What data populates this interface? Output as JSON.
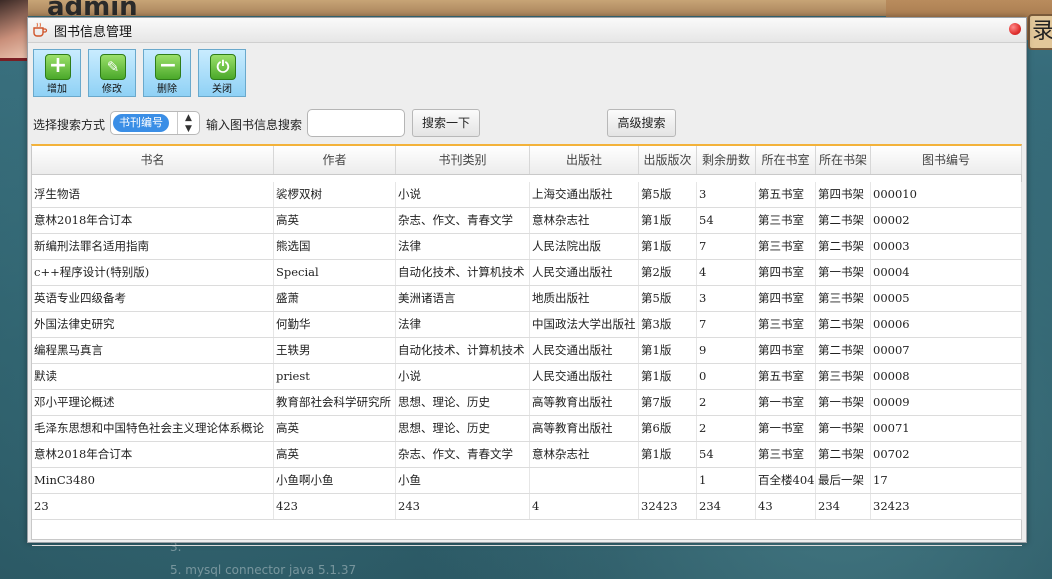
{
  "background": {
    "user_label": "admin",
    "right_char": "录",
    "note_line1": "3.",
    "note_line2": "5. mysql connector java 5.1.37"
  },
  "window": {
    "title": "图书信息管理"
  },
  "toolbar": {
    "buttons": [
      {
        "label": "增加",
        "icon": "+"
      },
      {
        "label": "修改",
        "icon": "✎"
      },
      {
        "label": "删除",
        "icon": "−"
      },
      {
        "label": "关闭",
        "icon": "⏻"
      }
    ]
  },
  "search": {
    "mode_label": "选择搜索方式",
    "mode_selected": "书刊编号",
    "input_label": "输入图书信息搜索",
    "input_value": "",
    "search_button": "搜索一下",
    "advanced_button": "高级搜索"
  },
  "table": {
    "columns": [
      "书名",
      "作者",
      "书刊类别",
      "出版社",
      "出版版次",
      "剩余册数",
      "所在书室",
      "所在书架",
      "图书编号"
    ],
    "rows": [
      [
        "浮生物语",
        "裟椤双树",
        "小说",
        "上海交通出版社",
        "第5版",
        "3",
        "第五书室",
        "第四书架",
        "000010"
      ],
      [
        "意林2018年合订本",
        "高英",
        "杂志、作文、青春文学",
        "意林杂志社",
        "第1版",
        "54",
        "第三书室",
        "第二书架",
        "00002"
      ],
      [
        "新编刑法罪名适用指南",
        "熊选国",
        "法律",
        "人民法院出版",
        "第1版",
        "7",
        "第三书室",
        "第二书架",
        "00003"
      ],
      [
        "c++程序设计(特别版)",
        "Special",
        "自动化技术、计算机技术",
        "人民交通出版社",
        "第2版",
        "4",
        "第四书室",
        "第一书架",
        "00004"
      ],
      [
        "英语专业四级备考",
        "盛萧",
        "美洲诸语言",
        "地质出版社",
        "第5版",
        "3",
        "第四书室",
        "第三书架",
        "00005"
      ],
      [
        "外国法律史研究",
        "何勤华",
        "法律",
        "中国政法大学出版社",
        "第3版",
        "7",
        "第三书室",
        "第二书架",
        "00006"
      ],
      [
        "编程黑马真言",
        "王轶男",
        "自动化技术、计算机技术",
        "人民交通出版社",
        "第1版",
        "9",
        "第四书室",
        "第二书架",
        "00007"
      ],
      [
        "默读",
        "priest",
        "小说",
        "人民交通出版社",
        "第1版",
        "0",
        "第五书室",
        "第三书架",
        "00008"
      ],
      [
        "邓小平理论概述",
        "教育部社会科学研究所",
        "思想、理论、历史",
        "高等教育出版社",
        "第7版",
        "2",
        "第一书室",
        "第一书架",
        "00009"
      ],
      [
        "毛泽东思想和中国特色社会主义理论体系概论",
        "高英",
        "思想、理论、历史",
        "高等教育出版社",
        "第6版",
        "2",
        "第一书室",
        "第一书架",
        "00071"
      ],
      [
        "意林2018年合订本",
        "高英",
        "杂志、作文、青春文学",
        "意林杂志社",
        "第1版",
        "54",
        "第三书室",
        "第二书架",
        "00702"
      ],
      [
        "MinC3480",
        "小鱼啊小鱼",
        "小鱼",
        "",
        "",
        "1",
        "百全楼404",
        "最后一架",
        "17"
      ],
      [
        "23",
        "423",
        "243",
        "4",
        "32423",
        "234",
        "43",
        "234",
        "32423"
      ]
    ]
  },
  "colors": {
    "accent_orange": "#f3b23a",
    "toolbar_blue": "#8fd1f5",
    "selected_pill": "#3a8ee6",
    "close_red": "#e0302e"
  }
}
